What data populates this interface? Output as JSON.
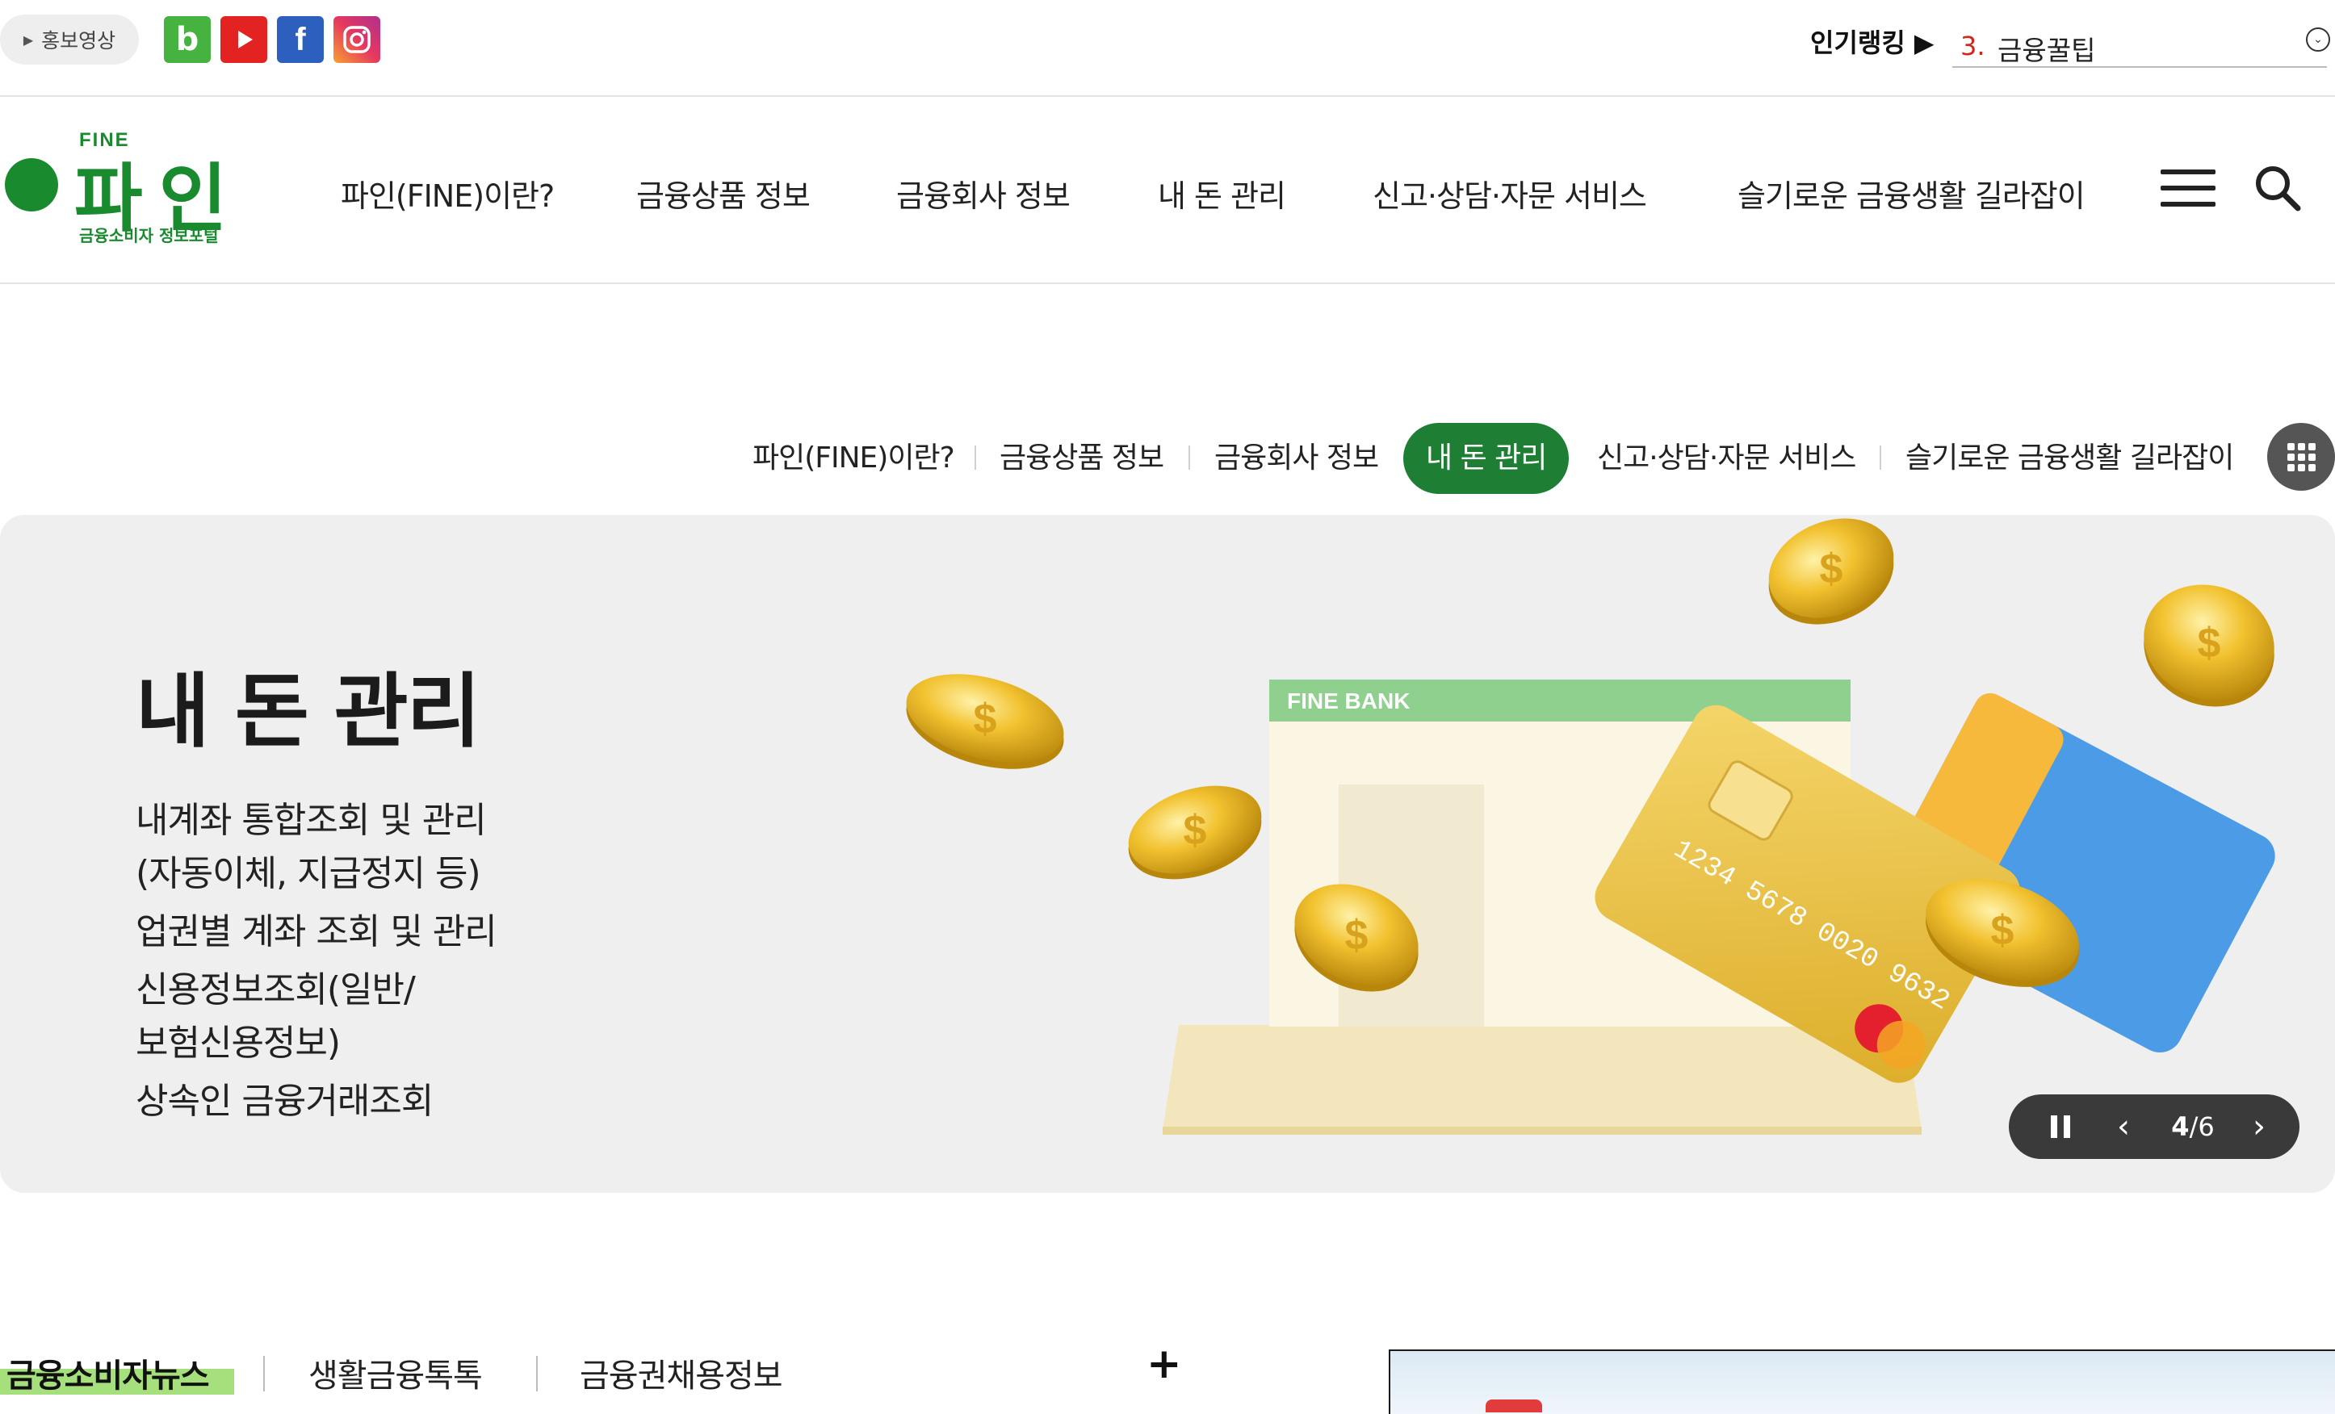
{
  "topbar": {
    "promo_label": "홍보영상",
    "sns": [
      {
        "name": "blog",
        "glyph": "b",
        "color": "#46b340"
      },
      {
        "name": "youtube",
        "glyph": "▶",
        "color": "#e32222"
      },
      {
        "name": "facebook",
        "glyph": "f",
        "color": "#2d5fbe"
      },
      {
        "name": "instagram",
        "glyph": "instagram-icon",
        "color": "#e6385f"
      }
    ],
    "ranking": {
      "label": "인기랭킹 ▶",
      "number": "3.",
      "item": "금융꿀팁"
    }
  },
  "header": {
    "logo": {
      "top": "FINE",
      "name": "파인",
      "sub": "금융소비자 정보포털",
      "color": "#1a8a2e"
    },
    "gnb": [
      "파인(FINE)이란?",
      "금융상품 정보",
      "금융회사 정보",
      "내 돈 관리",
      "신고·상담·자문 서비스",
      "슬기로운 금융생활 길라잡이"
    ]
  },
  "subnav": {
    "items": [
      "파인(FINE)이란?",
      "금융상품 정보",
      "금융회사 정보",
      "내 돈 관리",
      "신고·상담·자문 서비스",
      "슬기로운 금융생활 길라잡이"
    ],
    "active_index": 3,
    "active_color": "#1e7f34"
  },
  "hero": {
    "title": "내 돈 관리",
    "lines": [
      "내계좌 통합조회 및 관리",
      "(자동이체, 지급정지 등)",
      "업권별 계좌 조회 및 관리",
      "신용정보조회(일반/",
      "보험신용정보)",
      "상속인 금융거래조회"
    ],
    "illustration": {
      "bank_label": "FINE BANK",
      "card_number": "1234 5678 0020 9632",
      "coin_symbol": "$"
    },
    "slider": {
      "current": "4",
      "separator": "/",
      "total": "6"
    }
  },
  "news": {
    "tabs": [
      "금융소비자뉴스",
      "생활금융톡톡",
      "금융권채용정보"
    ],
    "more": "+",
    "highlight_color": "#a6e07c"
  }
}
